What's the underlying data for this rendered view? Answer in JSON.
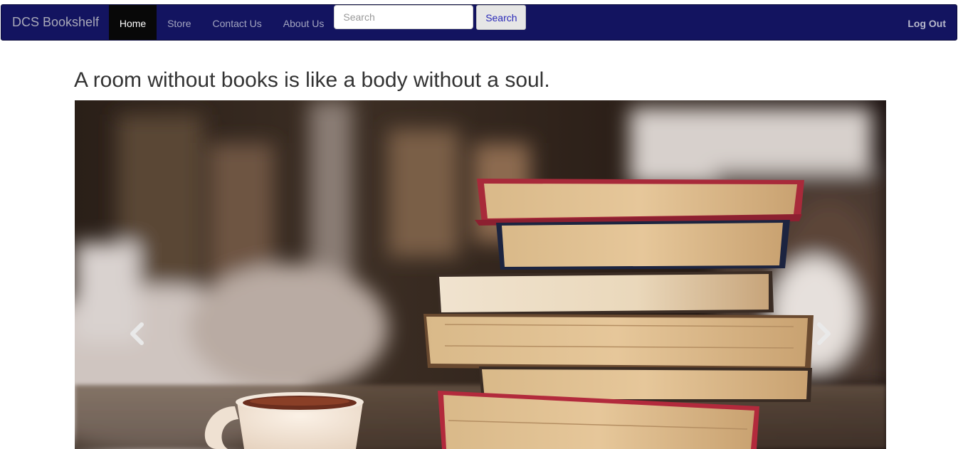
{
  "navbar": {
    "brand": "DCS Bookshelf",
    "links": [
      {
        "label": "Home",
        "active": true
      },
      {
        "label": "Store",
        "active": false
      },
      {
        "label": "Contact Us",
        "active": false
      },
      {
        "label": "About Us",
        "active": false
      }
    ],
    "search": {
      "placeholder": "Search",
      "value": "",
      "button_label": "Search"
    },
    "logout_label": "Log Out"
  },
  "main": {
    "quote": "A room without books is like a body without a soul.",
    "carousel": {
      "prev_icon": "chevron-left-icon",
      "next_icon": "chevron-right-icon"
    }
  },
  "colors": {
    "navbar_bg": "#131460",
    "active_link_bg": "#080808",
    "search_button_text": "#2a2ab8"
  }
}
